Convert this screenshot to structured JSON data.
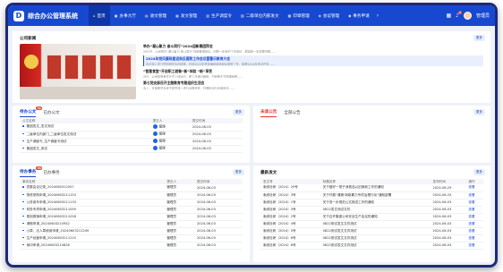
{
  "app": {
    "logo_letter": "D",
    "title": "综合办公管理系统"
  },
  "nav": [
    {
      "icon": "home-icon",
      "glyph": "⌂",
      "label": "首页",
      "active": true
    },
    {
      "icon": "briefcase-icon",
      "glyph": "▣",
      "label": "办事大厅"
    },
    {
      "icon": "inbox-icon",
      "glyph": "▤",
      "label": "收文管理"
    },
    {
      "icon": "send-icon",
      "glyph": "▦",
      "label": "发文管理"
    },
    {
      "icon": "order-icon",
      "glyph": "▧",
      "label": "生产调度令"
    },
    {
      "icon": "forward-icon",
      "glyph": "▨",
      "label": "二级单位内部发文"
    },
    {
      "icon": "seal-icon",
      "glyph": "▩",
      "label": "印章管理"
    },
    {
      "icon": "meeting-icon",
      "glyph": "◈",
      "label": "会议管理"
    },
    {
      "icon": "service-icon",
      "glyph": "◆",
      "label": "事务申请"
    }
  ],
  "top_right": {
    "notification_count": "8",
    "user_name": "管理员"
  },
  "news": {
    "title": "公司新闻",
    "more": "更多",
    "items": [
      {
        "title": "举办“凝心聚力 奋斗同行”2024迎新春团拜会",
        "desc": "2月7日，公司举办“凝心聚力 奋斗同行”迎新春团拜会，回顾一年来的工作成绩，展望新一年发展蓝图……"
      },
      {
        "title": "2024年党风廉政建设和反腐败工作会议暨警示教育大会",
        "desc": "会议深入学习贯彻相关会议精神，总结2023年党风廉政建设和反腐败工作，部署2024年重点任务……",
        "highlight": true
      },
      {
        "title": "“智慧食堂”开启职工就餐“新”体验 “新”享受",
        "desc": "近日，公司智慧食堂正式上线运行，职工可通过刷脸、扫码等方式快捷就餐……"
      },
      {
        "title": "第七党支部召开主题教育专题组织生活会",
        "desc": "会上，支部委员会班子成员逐一进行对照检查，开展批评与自我批评……"
      }
    ]
  },
  "todo": {
    "tabs": [
      {
        "label": "待办公文",
        "badge": "31"
      },
      {
        "label": "已办公文"
      }
    ],
    "more": "更多",
    "columns": [
      "公文名称",
      "提交人",
      "提交时间"
    ],
    "rows": [
      {
        "name": "集团发文_发文测试",
        "user": "管理",
        "date": "2024-06-03"
      },
      {
        "name": "二级单位内部门_二级单位发文测试",
        "user": "管理",
        "date": "2024-06-03"
      },
      {
        "name": "生产调度令_生产调度令测试",
        "user": "管理",
        "date": "2024-06-03"
      },
      {
        "name": "集团发文_测试",
        "user": "管理",
        "date": "2024-06-03"
      }
    ]
  },
  "notice": {
    "tabs": [
      {
        "label": "未读公告"
      },
      {
        "label": "全部公告"
      }
    ],
    "more": "更多"
  },
  "affairs": {
    "tabs": [
      {
        "label": "待办事务",
        "badge": "55"
      },
      {
        "label": "已办事务"
      }
    ],
    "more": "更多",
    "columns": [
      "事务名称",
      "提交人",
      "提交时间"
    ],
    "rows": [
      {
        "name": "党委会议记录_2024060312057",
        "user": "管理员",
        "date": "2024-06-03"
      },
      {
        "name": "物资采购申请_20240603211153",
        "user": "管理员",
        "date": "2024-06-03"
      },
      {
        "name": "公务用车申请_20240603211133",
        "user": "管理员",
        "date": "2024-06-03"
      },
      {
        "name": "财务专项申请_20240603211059",
        "user": "管理员",
        "date": "2024-06-03"
      },
      {
        "name": "费用报销申请_20240603211028",
        "user": "管理员",
        "date": "2024-06-03"
      },
      {
        "name": "请假申请_20240603210952",
        "user": "管理员",
        "date": "2024-06-03"
      },
      {
        "name": "公章、法人章使用申请_20240603211249",
        "user": "管理员",
        "date": "2024-06-03"
      },
      {
        "name": "生产经营申请_20240603211215",
        "user": "管理员",
        "date": "2024-06-03"
      },
      {
        "name": "用印申请_20240603210828",
        "user": "管理员",
        "date": "2024-06-03"
      }
    ]
  },
  "latest": {
    "title": "最新发文",
    "more": "更多",
    "columns": [
      "发文号",
      "标题名称",
      "发布时间",
      "操作"
    ],
    "rows": [
      {
        "no": "索综社研〔2024〕29号",
        "title": "关于做好一揽子消费品以旧换新工作的通知",
        "date": "2024-06-29",
        "op": "查看"
      },
      {
        "no": "索综社研〔2024〕3号",
        "title": "关于开展“清朗·网络暴力专项治理行动”通知部署",
        "date": "2024-06-25",
        "op": "查看"
      },
      {
        "no": "索综社研〔2024〕1号",
        "title": "关于进一步规范公文报送工作的通知",
        "date": "2024-06-03",
        "op": "查看"
      },
      {
        "no": "索综社研〔2024〕3号",
        "title": "0822发文测试文件",
        "date": "2024-06-03",
        "op": "查看"
      },
      {
        "no": "索综社研〔2024〕2号",
        "title": "关于召开集团公司安全生产会议的通知",
        "date": "2024-06-03",
        "op": "查看"
      },
      {
        "no": "索综社研〔2024〕4号",
        "title": "0822测试发文文件测试",
        "date": "2024-06-03",
        "op": "查看"
      },
      {
        "no": "索综社研〔2024〕5号",
        "title": "0822测试发文文件测试",
        "date": "2024-06-03",
        "op": "查看"
      },
      {
        "no": "索综社研〔2024〕6号",
        "title": "0822测试发文文件测试",
        "date": "2024-06-03",
        "op": "查看"
      },
      {
        "no": "索综社研〔2024〕6号",
        "title": "0822测试发文文件测试",
        "date": "2024-06-03",
        "op": "查看"
      }
    ]
  }
}
